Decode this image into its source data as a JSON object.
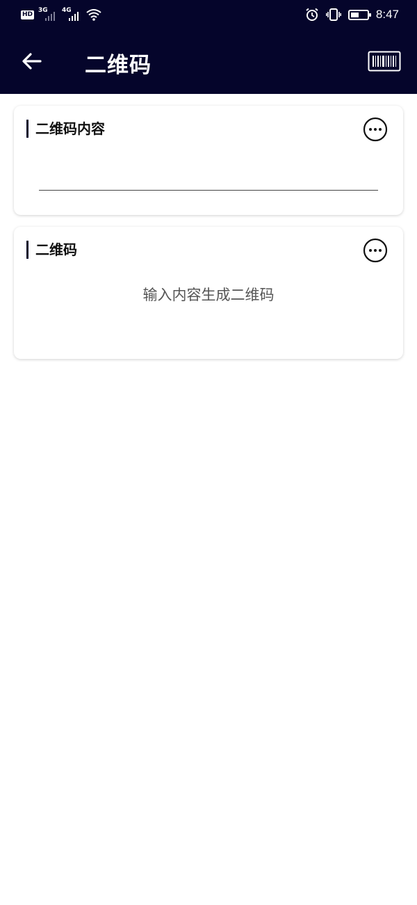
{
  "status_bar": {
    "hd_badge": "HD",
    "network_1": "3G",
    "network_2": "4G",
    "time": "8:47",
    "icons": [
      "alarm-icon",
      "vibrate-icon",
      "battery-icon",
      "wifi-icon"
    ]
  },
  "app_bar": {
    "title": "二维码",
    "back_icon": "arrow-left-icon",
    "action_icon": "barcode-icon"
  },
  "content_card": {
    "title": "二维码内容",
    "input_value": "",
    "menu_icon": "more-horizontal-icon"
  },
  "qr_card": {
    "title": "二维码",
    "hint": "输入内容生成二维码",
    "menu_icon": "more-horizontal-icon"
  },
  "colors": {
    "header_bg": "#05052b",
    "accent": "#05052b",
    "page_bg": "#ffffff"
  }
}
